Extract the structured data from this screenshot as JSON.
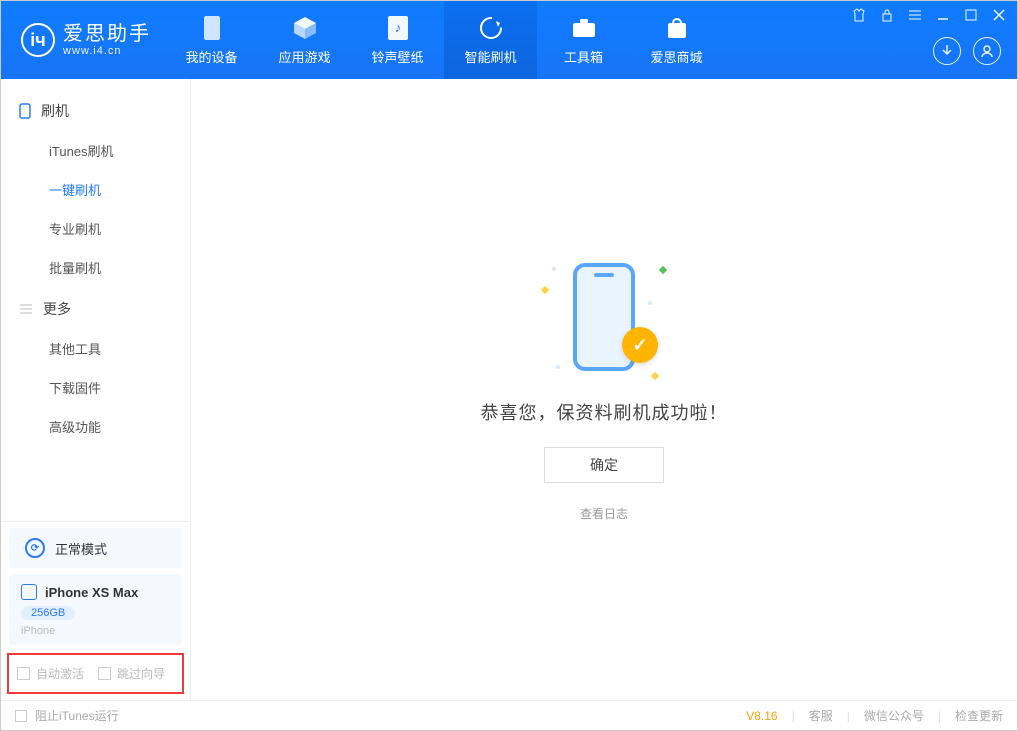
{
  "app": {
    "title": "爱思助手",
    "subtitle": "www.i4.cn"
  },
  "nav": {
    "items": [
      {
        "label": "我的设备"
      },
      {
        "label": "应用游戏"
      },
      {
        "label": "铃声壁纸"
      },
      {
        "label": "智能刷机"
      },
      {
        "label": "工具箱"
      },
      {
        "label": "爱思商城"
      }
    ],
    "active_index": 3
  },
  "sidebar": {
    "groups": [
      {
        "title": "刷机",
        "items": [
          "iTunes刷机",
          "一键刷机",
          "专业刷机",
          "批量刷机"
        ],
        "active_index": 1
      },
      {
        "title": "更多",
        "items": [
          "其他工具",
          "下载固件",
          "高级功能"
        ],
        "active_index": -1
      }
    ]
  },
  "device": {
    "mode_label": "正常模式",
    "name": "iPhone XS Max",
    "capacity": "256GB",
    "type": "iPhone"
  },
  "options": {
    "auto_activate_label": "自动激活",
    "skip_wizard_label": "跳过向导"
  },
  "main": {
    "success_text": "恭喜您，保资料刷机成功啦！",
    "ok_label": "确定",
    "log_link": "查看日志"
  },
  "footer": {
    "block_itunes_label": "阻止iTunes运行",
    "version": "V8.16",
    "links": [
      "客服",
      "微信公众号",
      "检查更新"
    ]
  }
}
